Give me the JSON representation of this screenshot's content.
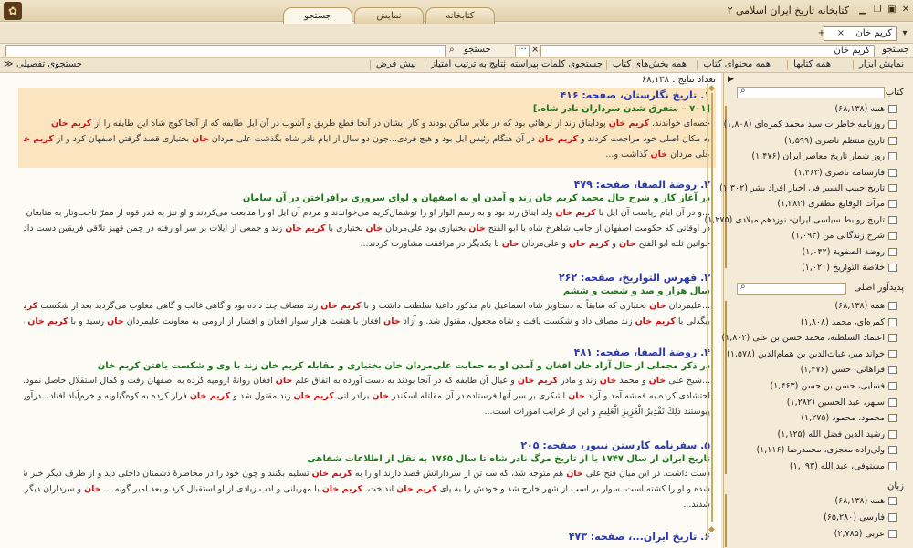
{
  "window": {
    "title": "کتابخانه تاریخ ایران اسلامی ۲"
  },
  "tabs": [
    {
      "label": "کتابخانه"
    },
    {
      "label": "نمایش"
    },
    {
      "label": "جستجو"
    }
  ],
  "search": {
    "term": "کریم خان",
    "add_label": "+",
    "label": "جستجو",
    "term2": "کریم خان",
    "detailed_label": "جستجوی تفصیلی"
  },
  "toolbar": {
    "items": [
      "نمایش ابزار",
      "همه کتابها",
      "همه محتوای کتاب",
      "همه بخش‌های کتاب",
      "جستجوی کلمات پیراسته",
      "نتایج به ترتیب امتیاز",
      "پیش فرض",
      "چیدمان"
    ]
  },
  "results": {
    "count_label": "تعداد نتایج : ۶۸,۱۳۸",
    "items": [
      {
        "title": "۱. تاریخ نگارستان، صفحه: ۴۱۶",
        "subtitle": "[۷۰۱ – متفرق شدن سرداران نادر شاه.]",
        "lines": [
          "حصه‌ای خواندند. کریم خان پودایناق زند از لرهائی بود که در ملایر ساکن بودند و کار ایشان در آنجا قطع طریق و آشوب در آن ایل طایفه که از آنجا کوچ شاه این طایفه را از کریم خان",
          "به مکان اصلی خود مراجعت کردند و کریم خان در آن هنگام رئیس ایل بود و هیچ فردی...چون دو سال از ایام نادر شاه بگذشت علی مردان خان بختیاری قصد گرفتن اصفهان کرد و از کریم خان یاری خواست او نیز دوستی در اختیار",
          "علی مردان خان گذاشت و..."
        ]
      },
      {
        "title": "۲. روضة الصفا، صفحه: ۴۷۹",
        "subtitle": "در آغاز کار و شرح حال محمد کریم خان زند و آمدن او به اصفهان و لوای سروری برافراختن در آن سامان",
        "lines": [
          "...و در آن ایام ریاست آن ایل با کریم خان ولد ایناق زند بود و به رسم الوار او را توشمال‌کریم می‌خواندند و مردم آن ایل او را متابعت می‌کردند و او نیز به قدر قوه از ممرّ تاخت‌وتاز به متابعان خود نفعی می‌رسانید و پیروی او گزیده بودند. و",
          "در اوقاتی که حکومت اصفهان از جانب شاهرخ شاه با ابو الفتح خان بختیاری بود علی‌مردان خان بختیاری با کریم خان زند و جمعی از ایلات بر سر او رفته در چمن قهیز تلاقی فریقین دست داد و ابو الفتح خان مغلوب شد، و پس از آن",
          "خوانین ثلثه ابو الفتح خان و کریم خان و علی‌مردان خان با یکدیگر در مرافقت مشاورت کردند..."
        ]
      },
      {
        "title": "۳. فهرس التواریخ، صفحه: ۲۶۲",
        "subtitle": "سال هزار و صد و شصت و ششم",
        "lines": [
          "...علیمردان خان بختیاری که سابقاً به دستاویز شاه اسماعیل نام مذکور داعیهٔ سلطنت داشت و با کریم خان زند مصاف چند داده بود و گاهی غالب و گاهی مغلوب می‌گردید بعد از شکست کریم خان...دیگرباره به مرافقت مصطفی خان",
          "بیگدلی با کریم خان زند مصاف داد و شکست یافت و شاه مجعول، مقتول شد. و آزاد خان افغان با هشت هزار سوار افغان و افشار از ارومی به معاونت علیمردان خان رسید و با کریم خان مقاتله و محاربه درپیوست..."
        ]
      },
      {
        "title": "۴. روضة الصفا، صفحه: ۴۸۱",
        "subtitle": "در ذکر مجملی از حال آزاد خان افغان و آمدن او به حمایت علی‌مردان خان بختیاری و مقابله کریم خان زند با وی و شکست یافتن کریم خان",
        "lines": [
          "...شیخ علی خان و محمد خان زند و مادر کریم خان و عیال آن طایفه که در آنجا بودند به دست آورده به اتفاق علم خان افغان روانهٔ ارومیه کرده به اصفهان رفت و کمال استقلال حاصل نمود. و کریم خان وکیل به فارس گریخت و",
          "احتشادی کرده به قمشه آمد و آزاد خان لشکری بر سر آنها فرستاده در آن مقاتله اسکندر خان برادر اتی کریم خان زند مقتول شد و کریم خان فرار کرده به کوه‌گیلویه و خرم‌آباد افتاد...درآورده در نواحی بروجرد به کریم خان",
          "پیوستند ذلِكَ تَقْدِيرُ الْعَزِيزِ الْعَلِيمِ و این از غرایب امورات است..."
        ]
      },
      {
        "title": "۵. سفرنامه کارستن نیبور، صفحه: ۲۰۵",
        "subtitle": "تاریخ ایران از سال ۱۷۴۷ یا از تاریخ مرگ نادر شاه تا سال ۱۷۶۵ به نقل از اطلاعات شفاهی",
        "lines": [
          "دست داشت. در این میان فتح علی خان هم متوجه شد، که سه تن از سردارانش قصد دارند او را به کریم خان تسلیم بکنند و چون خود را در محاصرهٔ دشمنان داخلی دید و از طرف دیگر خبر شد، که کریم خان از نقشهٔ ابراهیم خان آگاه",
          "شده و او را کشته است، سوار بر اسب از شهر خارج شد و خودش را به پای کریم خان انداخت. کریم خان با مهربانی و ادب زیادی از او استقبال کرد و بعد امیر گونه ... خان و سرداران دیگر قلعهٔ ارومیه هم به میل خود تسلیم کریم خان",
          "شدند..."
        ]
      },
      {
        "title": "۶. تاریخ ایران...، صفحه: ۴۷۳",
        "subtitle": "",
        "lines": []
      }
    ]
  },
  "sidebar": {
    "books_label": "کتاب",
    "books": [
      "همه (۶۸,۱۳۸)",
      "روزنامه خاطرات سید محمد کمره‌ای (۱,۸۰۸)",
      "تاریخ منتظم ناصری (۱,۵۹۹)",
      "روز شمار تاریخ معاصر ایران (۱,۴۷۶)",
      "فارسنامه ناصری (۱,۴۶۳)",
      "تاریخ حبیب السیر فی اخبار افراد بشر (۱,۳۰۲)",
      "مرآت الوقایع مظفری (۱,۲۸۲)",
      "تاریخ روابط سیاسی ایران- نوزدهم میلادی (۱,۲۷۵)",
      "شرح زندگانی من (۱,۰۹۳)",
      "روضة الصفویة (۱,۰۴۲)",
      "خلاصة التواریخ (۱,۰۲۰)"
    ],
    "authors_label": "پدیدآور اصلی",
    "authors": [
      "همه (۶۸,۱۳۸)",
      "کمره‌ای، محمد (۱,۸۰۸)",
      "اعتماد السلطنه، محمد حسن بن علی (۱,۸۰۲)",
      "خواند میر، غیاث‌الدین بن همام‌الدین (۱,۵۷۸)",
      "فراهانی، حسن (۱,۴۷۶)",
      "فسایی، حسن بن حسن (۱,۴۶۳)",
      "سپهر، عبد الحسین (۱,۲۸۲)",
      "محمود، محمود (۱,۲۷۵)",
      "رشید الدین فضل الله (۱,۱۲۵)",
      "ولی‌زاده معجزی، محمدرضا (۱,۱۱۶)",
      "مستوفی، عبد الله (۱,۰۹۳)"
    ],
    "lang_label": "زبان",
    "languages": [
      "همه (۶۸,۱۳۸)",
      "فارسی (۶۵,۲۸۰)",
      "عربی (۲,۷۸۵)"
    ]
  },
  "colors": {
    "highlight": "#c8161a",
    "title": "#2a3ab0",
    "subtitle": "#1a7a1a",
    "accent": "#fbe4c0"
  }
}
